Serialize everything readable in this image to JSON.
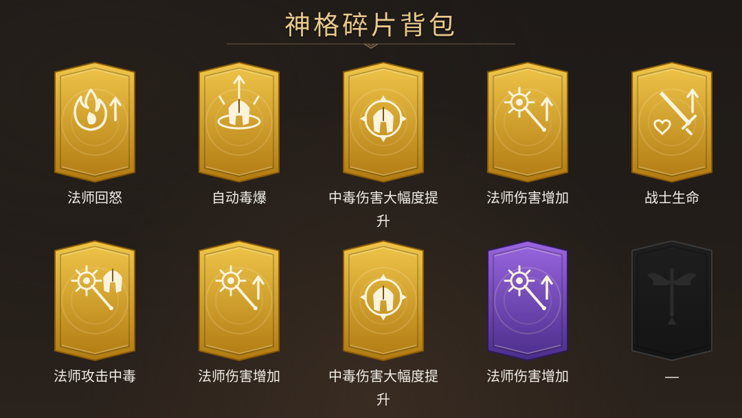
{
  "page": {
    "title": "神格碎片背包"
  },
  "colors": {
    "gold_light": "#f0c64a",
    "gold_dark": "#b07a12",
    "purple_light": "#9a66e0",
    "purple_dark": "#4a2d8a",
    "empty": "#141414",
    "icon": "#fbf3dc"
  },
  "cards": [
    {
      "label": "法师回怒",
      "rarity": "gold",
      "icon": "flame-up-icon"
    },
    {
      "label": "自动毒爆",
      "rarity": "gold",
      "icon": "helmet-burst-icon"
    },
    {
      "label": "中毒伤害大幅度提升",
      "rarity": "gold",
      "icon": "helmet-target-icon"
    },
    {
      "label": "法师伤害增加",
      "rarity": "gold",
      "icon": "mace-up-icon"
    },
    {
      "label": "战士生命",
      "rarity": "gold",
      "icon": "sword-heart-up-icon"
    },
    {
      "label": "法师攻击中毒",
      "rarity": "gold",
      "icon": "mace-helmet-icon"
    },
    {
      "label": "法师伤害增加",
      "rarity": "gold",
      "icon": "mace-up-icon"
    },
    {
      "label": "中毒伤害大幅度提升",
      "rarity": "gold",
      "icon": "helmet-target-icon"
    },
    {
      "label": "法师伤害增加",
      "rarity": "purple",
      "icon": "mace-up-icon"
    },
    {
      "label": "—",
      "rarity": "empty",
      "icon": "winged-sword-icon"
    }
  ]
}
